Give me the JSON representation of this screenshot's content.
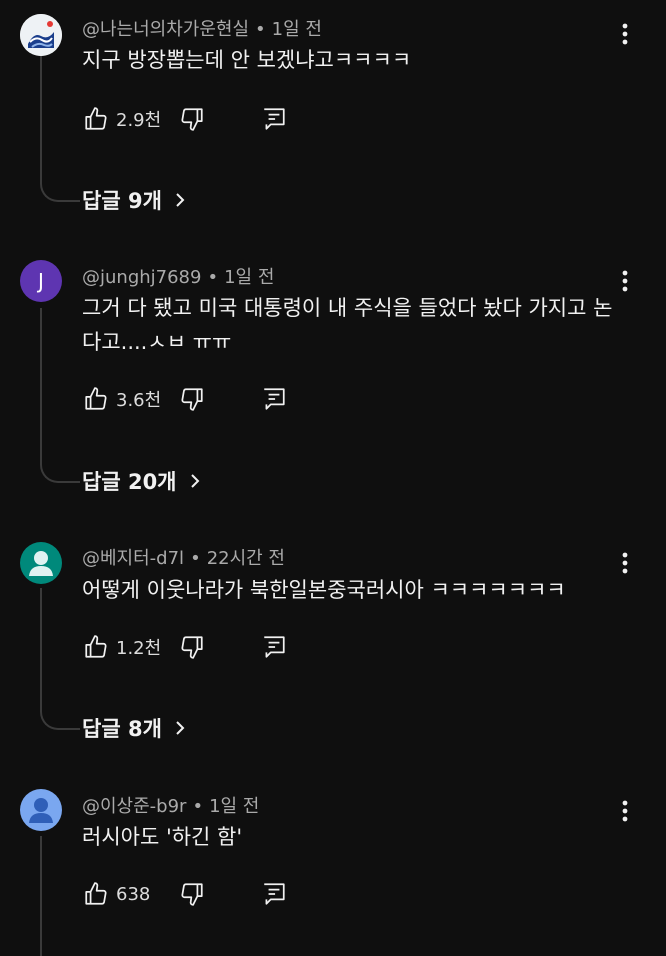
{
  "comments": [
    {
      "handle": "@나는너의차가운현실",
      "time": "1일 전",
      "text": "지구 방장뽑는데 안 보겠냐고ㅋㅋㅋㅋ",
      "likes": "2.9천",
      "replies_label": "답글 9개",
      "avatar_color": "#e8e8e8"
    },
    {
      "handle": "@junghj7689",
      "time": "1일 전",
      "text": "그거 다 됐고 미국 대통령이 내 주식을 들었다 놨다 가지고 논다고....ㅅㅂ ㅠㅠ",
      "likes": "3.6천",
      "replies_label": "답글 20개",
      "avatar_letter": "J",
      "avatar_color": "#5e35b1"
    },
    {
      "handle": "@베지터-d7l",
      "time": "22시간 전",
      "text": "어떻게 이웃나라가 북한일본중국러시아 ㅋㅋㅋㅋㅋㅋㅋ",
      "likes": "1.2천",
      "replies_label": "답글 8개",
      "avatar_color": "#00897b"
    },
    {
      "handle": "@이상준-b9r",
      "time": "1일 전",
      "text": "러시아도 '하긴 함'",
      "likes": "638",
      "avatar_color": "#7aa7f0"
    }
  ]
}
